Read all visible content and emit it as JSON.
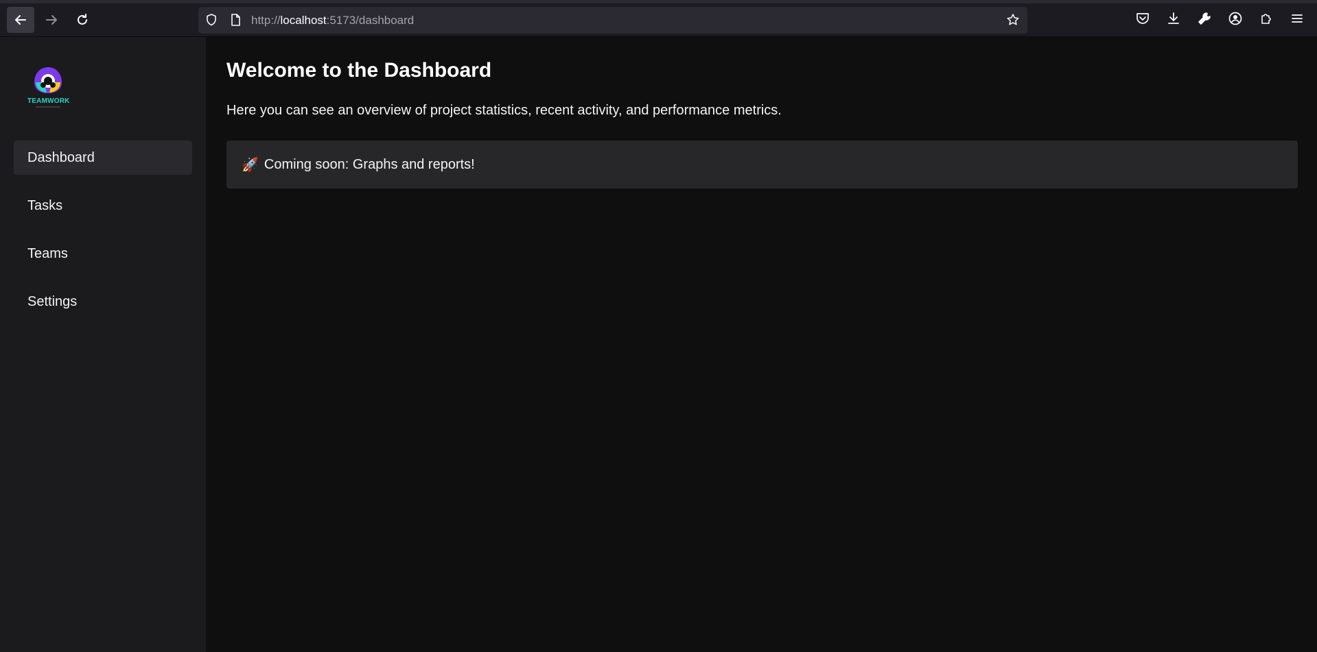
{
  "browser": {
    "url_prefix": "http://",
    "url_host": "localhost",
    "url_rest": ":5173/dashboard",
    "icons": [
      "back-arrow-icon",
      "forward-arrow-icon",
      "reload-icon",
      "shield-icon",
      "page-icon",
      "star-icon",
      "pocket-icon",
      "download-icon",
      "wrench-icon",
      "account-icon",
      "extensions-icon",
      "menu-icon"
    ]
  },
  "sidebar": {
    "logo_text": "TEAMWORK",
    "items": [
      {
        "label": "Dashboard",
        "active": true
      },
      {
        "label": "Tasks",
        "active": false
      },
      {
        "label": "Teams",
        "active": false
      },
      {
        "label": "Settings",
        "active": false
      }
    ]
  },
  "main": {
    "title": "Welcome to the Dashboard",
    "description": "Here you can see an overview of project statistics, recent activity, and performance metrics.",
    "notice": {
      "icon": "🚀",
      "text": "Coming soon: Graphs and reports!"
    }
  },
  "colors": {
    "background": "#0f0f10",
    "sidebar": "#1b1b1e",
    "active_item": "#2a2a2e",
    "notice_bg": "#27272a",
    "logo_accent": "#2dd4bf"
  }
}
